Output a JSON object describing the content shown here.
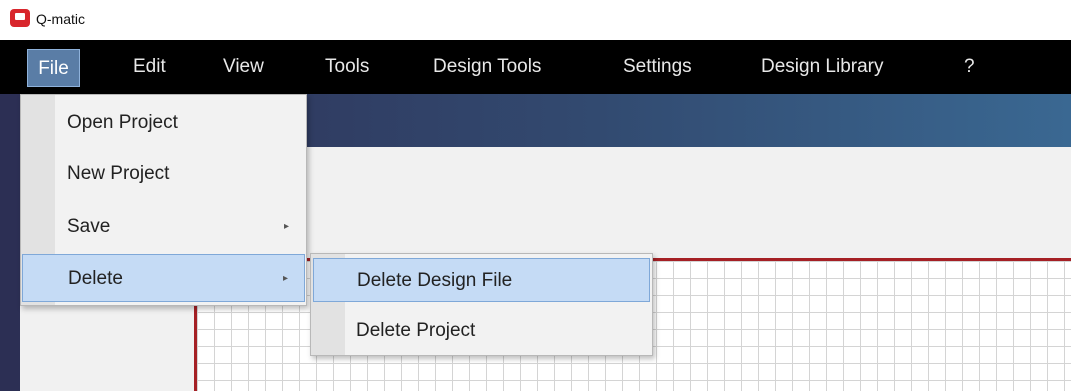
{
  "app": {
    "title": "Q-matic",
    "icon": "app-logo-icon",
    "brand_color": "#d8262c"
  },
  "menubar": {
    "items": [
      {
        "label": "File"
      },
      {
        "label": "Edit"
      },
      {
        "label": "View"
      },
      {
        "label": "Tools"
      },
      {
        "label": "Design Tools"
      },
      {
        "label": "Settings"
      },
      {
        "label": "Design Library"
      },
      {
        "label": "?"
      }
    ],
    "active_item": "File"
  },
  "file_menu": {
    "items": [
      {
        "label": "Open Project"
      },
      {
        "label": "New Project"
      },
      {
        "label": "Save",
        "has_submenu": true
      },
      {
        "label": "Delete",
        "has_submenu": true
      }
    ],
    "highlighted_item": "Delete",
    "submenu_arrow": "▸"
  },
  "delete_submenu": {
    "items": [
      {
        "label": "Delete Design File"
      },
      {
        "label": "Delete Project"
      }
    ],
    "highlighted_item": "Delete Design File"
  },
  "colors": {
    "menubar": "#000000",
    "highlight": "#c5dbf5",
    "design_border": "#a52025"
  }
}
